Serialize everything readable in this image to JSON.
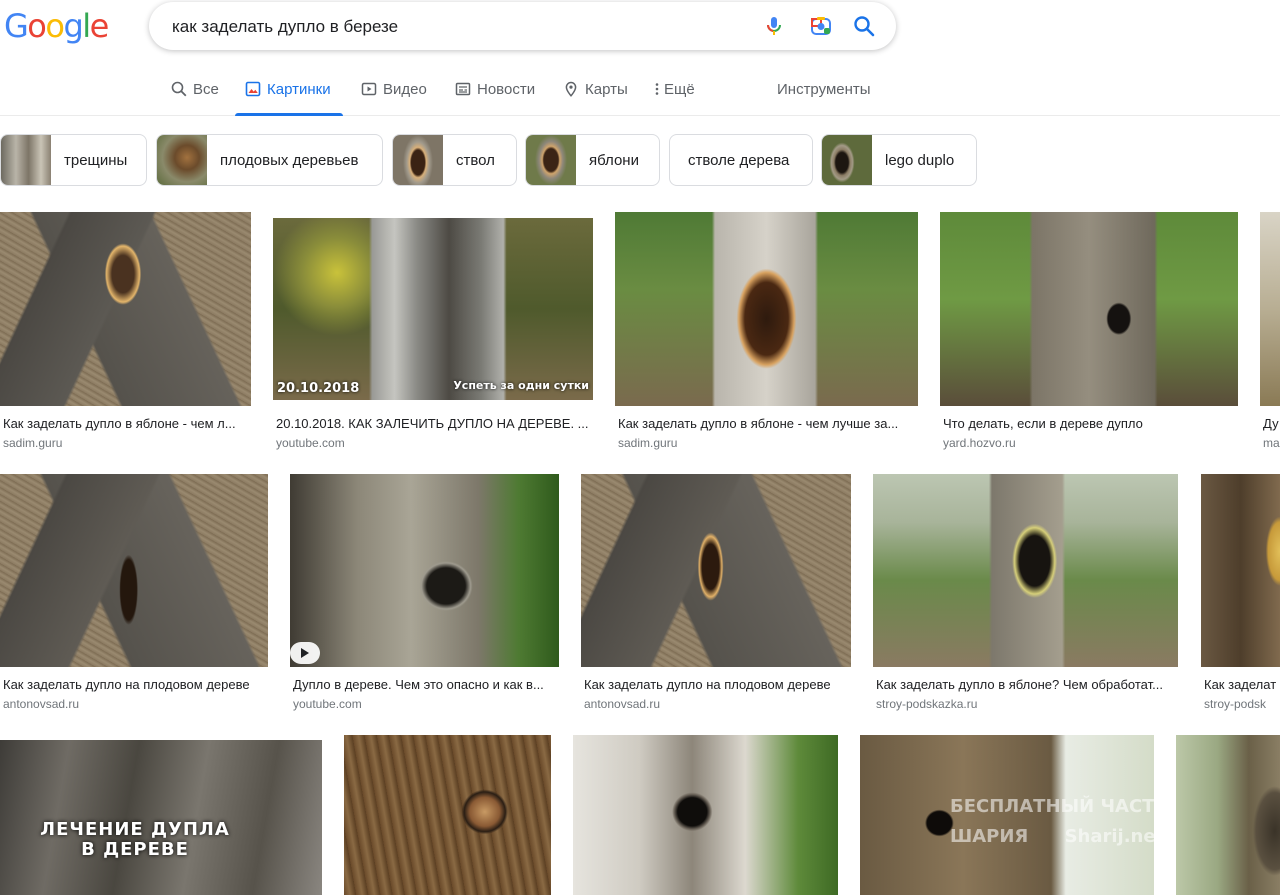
{
  "header": {
    "logo": [
      "G",
      "o",
      "o",
      "g",
      "l",
      "e"
    ],
    "logo_colors": [
      "#4285f4",
      "#ea4335",
      "#fbbc05",
      "#4285f4",
      "#34a853",
      "#ea4335"
    ],
    "query": "как заделать дупло в березе"
  },
  "tabs": [
    {
      "label": "Все"
    },
    {
      "label": "Картинки"
    },
    {
      "label": "Видео"
    },
    {
      "label": "Новости"
    },
    {
      "label": "Карты"
    },
    {
      "label": "Ещё"
    },
    {
      "label": "Инструменты"
    }
  ],
  "chips": [
    {
      "label": "трещины"
    },
    {
      "label": "плодовых деревьев"
    },
    {
      "label": "ствол"
    },
    {
      "label": "яблони"
    },
    {
      "label": "стволе дерева"
    },
    {
      "label": "lego duplo"
    }
  ],
  "results": [
    {
      "title": "Как заделать дупло в яблоне - чем л...",
      "source": "sadim.guru"
    },
    {
      "title": "20.10.2018. КАК ЗАЛЕЧИТЬ ДУПЛО НА ДЕРЕВЕ. ...",
      "source": "youtube.com",
      "overlay_date": "20.10.2018",
      "overlay_text": "Успеть за одни сутки"
    },
    {
      "title": "Как заделать дупло в яблоне - чем лучше за...",
      "source": "sadim.guru"
    },
    {
      "title": "Что делать, если в дереве дупло",
      "source": "yard.hozvo.ru"
    },
    {
      "title": "Ду",
      "source": "ma"
    },
    {
      "title": "Как заделать дупло на плодовом дереве",
      "source": "antonovsad.ru"
    },
    {
      "title": "Дупло в дереве. Чем это опасно и как в...",
      "source": "youtube.com"
    },
    {
      "title": "Как заделать дупло на плодовом дереве",
      "source": "antonovsad.ru"
    },
    {
      "title": "Как заделать дупло в яблоне? Чем обработат...",
      "source": "stroy-podskazka.ru"
    },
    {
      "title": "Как заделат",
      "source": "stroy-podsk"
    },
    {
      "overlay_line1": "ЛЕЧЕНИЕ ДУПЛА",
      "overlay_line2": "В ДЕРЕВЕ"
    },
    {},
    {},
    {
      "overlay_line1": "БЕСПЛАТНЫЙ ЧАСТНЫЙ",
      "overlay_line2": "ШАРИЯ",
      "overlay_line3": "Sharij.net"
    },
    {}
  ],
  "colors": {
    "accent": "#1a73e8",
    "text": "#202124",
    "muted": "#70757a",
    "tab_text": "#5f6368"
  }
}
